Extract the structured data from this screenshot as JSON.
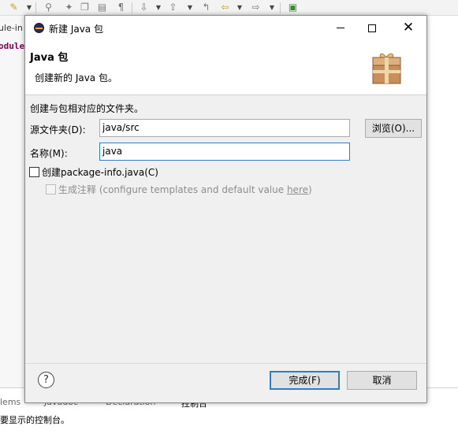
{
  "background": {
    "editor_tab_text": "ule-in",
    "editor_code_text": "odule",
    "bottom_tabs": [
      "lems",
      "Javadoc",
      "Declaration",
      "控制台"
    ],
    "console_text": "要显示的控制台。"
  },
  "dialog": {
    "title": "新建 Java 包",
    "header_title": "Java 包",
    "header_description": "创建新的 Java 包。",
    "content_label": "创建与包相对应的文件夹。",
    "source_folder": {
      "label": "源文件夹(D):",
      "value": "java/src",
      "browse_label": "浏览(O)..."
    },
    "name": {
      "label": "名称(M):",
      "value": "java"
    },
    "create_package_info": {
      "label": "创建package-info.java(C)",
      "checked": false
    },
    "generate_comments": {
      "label_prefix": "生成注释 (configure templates and default value ",
      "link": "here",
      "label_suffix": ")",
      "checked": false,
      "enabled": false
    },
    "finish_label": "完成(F)",
    "cancel_label": "取消"
  }
}
